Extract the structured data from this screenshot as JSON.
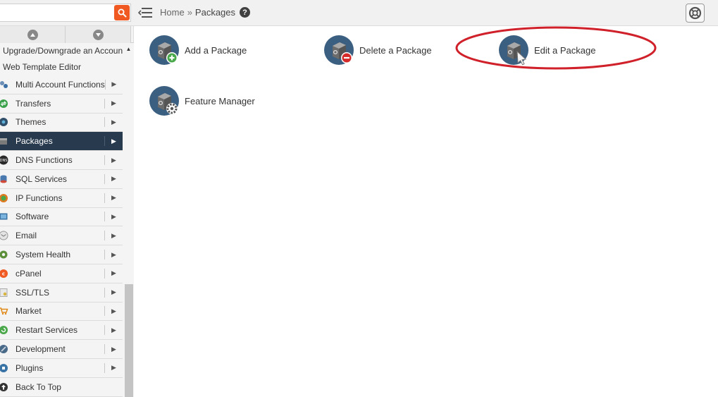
{
  "header": {
    "search": {
      "value": "",
      "placeholder": ""
    },
    "breadcrumb": {
      "home": "Home",
      "separator": "»",
      "current": "Packages"
    },
    "icons": {
      "search": "magnifier-icon",
      "collapse": "menu-collapse-icon",
      "help": "question-icon",
      "support": "lifebuoy-icon"
    },
    "help_glyph": "?"
  },
  "sidebar": {
    "sub_items": [
      {
        "label": "Upgrade/Downgrade an Account"
      },
      {
        "label": "Web Template Editor"
      }
    ],
    "items": [
      {
        "label": "Multi Account Functions",
        "icon": "accounts-icon",
        "arrow": "▶"
      },
      {
        "label": "Transfers",
        "icon": "transfers-icon",
        "arrow": "▶"
      },
      {
        "label": "Themes",
        "icon": "themes-icon",
        "arrow": "▶"
      },
      {
        "label": "Packages",
        "icon": "package-icon",
        "arrow": "▶",
        "active": true
      },
      {
        "label": "DNS Functions",
        "icon": "dns-icon",
        "arrow": "▶"
      },
      {
        "label": "SQL Services",
        "icon": "database-icon",
        "arrow": "▶"
      },
      {
        "label": "IP Functions",
        "icon": "ip-icon",
        "arrow": "▶"
      },
      {
        "label": "Software",
        "icon": "software-icon",
        "arrow": "▶"
      },
      {
        "label": "Email",
        "icon": "email-icon",
        "arrow": "▶"
      },
      {
        "label": "System Health",
        "icon": "system-health-icon",
        "arrow": "▶"
      },
      {
        "label": "cPanel",
        "icon": "cpanel-icon",
        "arrow": "▶"
      },
      {
        "label": "SSL/TLS",
        "icon": "certificate-icon",
        "arrow": "▶"
      },
      {
        "label": "Market",
        "icon": "cart-icon",
        "arrow": "▶"
      },
      {
        "label": "Restart Services",
        "icon": "restart-icon",
        "arrow": "▶"
      },
      {
        "label": "Development",
        "icon": "development-icon",
        "arrow": "▶"
      },
      {
        "label": "Plugins",
        "icon": "plugins-icon",
        "arrow": "▶"
      },
      {
        "label": "Back To Top",
        "icon": "arrow-up-icon",
        "arrow": ""
      }
    ]
  },
  "main": {
    "features": [
      {
        "label": "Add a Package",
        "icon": "add-package-icon",
        "badge": "plus"
      },
      {
        "label": "Delete a Package",
        "icon": "delete-package-icon",
        "badge": "no"
      },
      {
        "label": "Edit a Package",
        "icon": "edit-package-icon",
        "badge": "cursor",
        "highlighted": true
      },
      {
        "label": "Feature Manager",
        "icon": "feature-manager-icon",
        "badge": "gear"
      }
    ]
  },
  "colors": {
    "accent_orange": "#f05a22",
    "active_nav": "#283a4e",
    "icon_blue": "#3b5f80",
    "highlight_red": "#d0202a"
  }
}
